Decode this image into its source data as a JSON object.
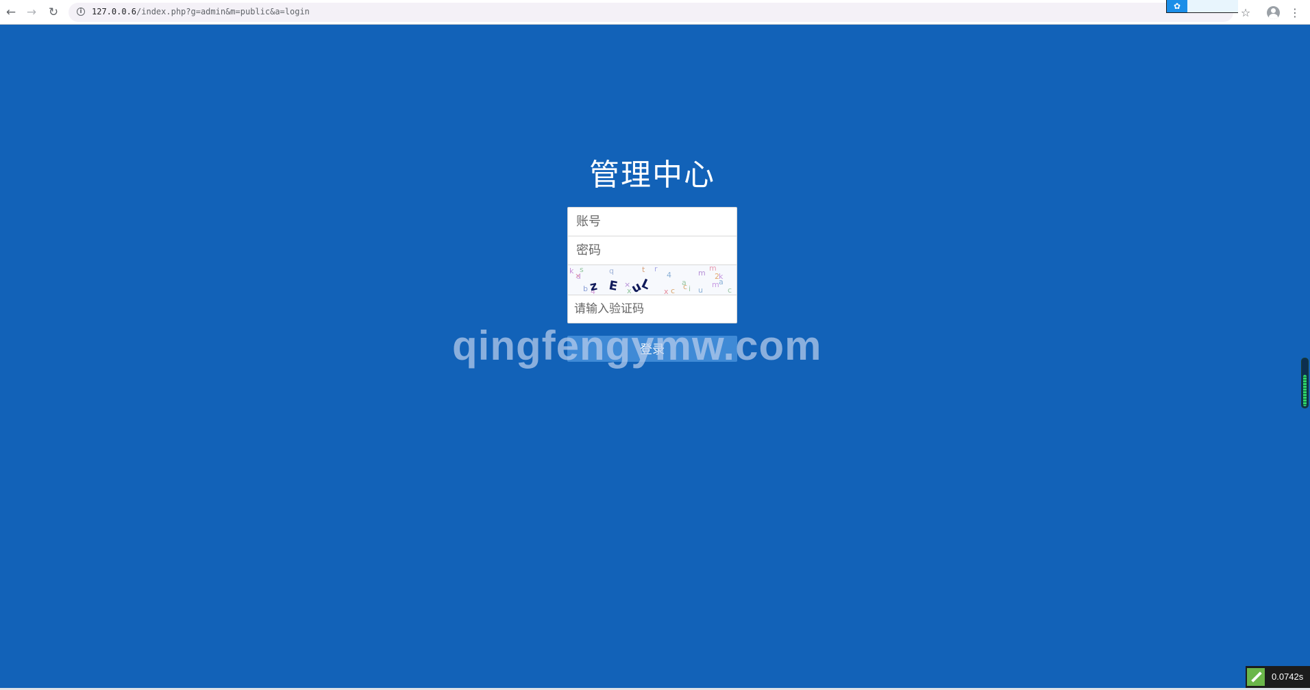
{
  "browser": {
    "url_host": "127.0.0.6",
    "url_path": "/index.php?g=admin&m=public&a=login"
  },
  "login": {
    "title": "管理中心",
    "account_placeholder": "账号",
    "password_placeholder": "密码",
    "captcha_placeholder": "请输入验证码",
    "submit_label": "登录"
  },
  "watermark": "qingfengymw.com",
  "debug": {
    "time": "0.0742s"
  },
  "colors": {
    "background": "#1262b8",
    "button": "#3f8ad6"
  }
}
